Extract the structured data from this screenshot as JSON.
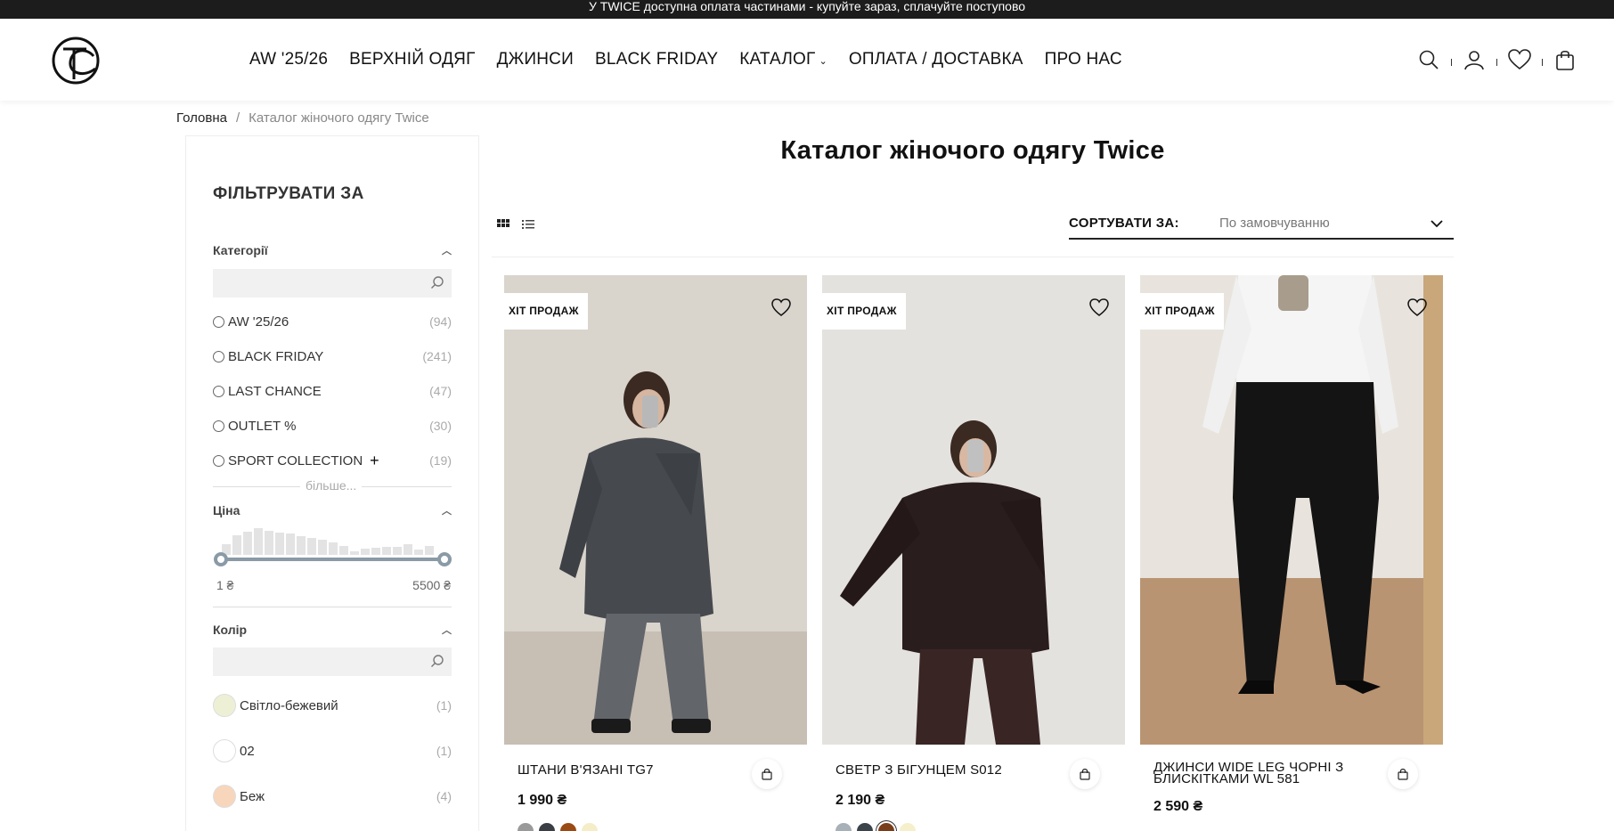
{
  "announcement": "У TWICE доступна оплата частинами - купуйте зараз, сплачуйте поступово",
  "nav": {
    "items": [
      {
        "label": "AW '25/26"
      },
      {
        "label": "ВЕРХНІЙ ОДЯГ"
      },
      {
        "label": "ДЖИНСИ"
      },
      {
        "label": "BLACK FRIDAY"
      },
      {
        "label": "КАТАЛОГ",
        "has_dropdown": true
      },
      {
        "label": "ОПЛАТА / ДОСТАВКА"
      },
      {
        "label": "ПРО НАС"
      }
    ],
    "icons": [
      "search-icon",
      "user-icon",
      "heart-icon",
      "bag-icon"
    ]
  },
  "breadcrumb": {
    "home": "Головна",
    "separator": "/",
    "current": "Каталог жіночого одягу Twice"
  },
  "filters": {
    "title": "ФІЛЬТРУВАТИ ЗА",
    "categories": {
      "label": "Категорії",
      "search_placeholder": "",
      "items": [
        {
          "label": "AW '25/26",
          "count": "(94)"
        },
        {
          "label": "BLACK FRIDAY",
          "count": "(241)"
        },
        {
          "label": "LAST CHANCE",
          "count": "(47)"
        },
        {
          "label": "OUTLET %",
          "count": "(30)"
        },
        {
          "label": "SPORT COLLECTION",
          "count": "(19)",
          "expandable": true
        }
      ],
      "more": "більше..."
    },
    "price": {
      "label": "Ціна",
      "min": "1 ₴",
      "max": "5500 ₴"
    },
    "color": {
      "label": "Колір",
      "search_placeholder": "",
      "items": [
        {
          "label": "Світло-бежевий",
          "count": "(1)",
          "hex": "#eef0d6"
        },
        {
          "label": "02",
          "count": "(1)",
          "hex": "#ffffff"
        },
        {
          "label": "Беж",
          "count": "(4)",
          "hex": "#f8d6bc"
        }
      ]
    }
  },
  "main": {
    "title": "Каталог жіночого одягу Twice",
    "sort_label": "СОРТУВАТИ ЗА:",
    "sort_value": "По замовчуванню"
  },
  "products": [
    {
      "badge": "ХІТ ПРОДАЖ",
      "name": "ШТАНИ В'ЯЗАНІ TG7",
      "price": "1 990 ₴",
      "swatches": [
        "#9a9a9a",
        "#3b3f45",
        "#9a4a14",
        "#f5edc8"
      ]
    },
    {
      "badge": "ХІТ ПРОДАЖ",
      "name": "СВЕТР З БІГУНЦЕМ S012",
      "price": "2 190 ₴",
      "swatches": [
        "#a8b0b8",
        "#3d434a",
        "#7a3d1a",
        "#f6efcb"
      ]
    },
    {
      "badge": "ХІТ ПРОДАЖ",
      "name": "ДЖИНСИ WIDE LEG ЧОРНІ З БЛИСКІТКАМИ WL 581",
      "price": "2 590 ₴",
      "swatches": [
        "#111111"
      ]
    }
  ],
  "colors": {
    "topbar_bg": "#1c1c1c",
    "slider": "#8a9aa6"
  }
}
